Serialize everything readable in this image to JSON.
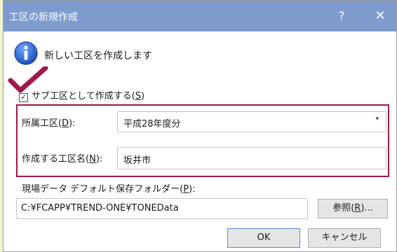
{
  "window": {
    "title": "工区の新規作成",
    "help_glyph": "?",
    "close_glyph": "✕"
  },
  "message": "新しい工区を作成します",
  "subchk": {
    "label_pre": "サブ工区として作成する(",
    "key": "S",
    "label_post": ")",
    "checked": true,
    "check_glyph": "✓"
  },
  "parent": {
    "label_pre": "所属工区(",
    "key": "D",
    "label_post": "):",
    "value": "平成28年度分",
    "arrow": "▾"
  },
  "name": {
    "label_pre": "作成する工区名(",
    "key": "N",
    "label_post": "):",
    "value": "坂井市"
  },
  "folder": {
    "label_pre": "現場データ デフォルト保存フォルダー(",
    "key": "P",
    "label_post": "):",
    "value": "C:¥FCAPP¥TREND-ONE¥TONEData"
  },
  "buttons": {
    "browse_pre": "参照(",
    "browse_key": "R",
    "browse_post": ")...",
    "ok": "OK",
    "cancel": "キャンセル"
  },
  "colors": {
    "titlebar": "#7e9bcd",
    "highlight": "#a0174b",
    "page_bg": "#eef6cf"
  }
}
